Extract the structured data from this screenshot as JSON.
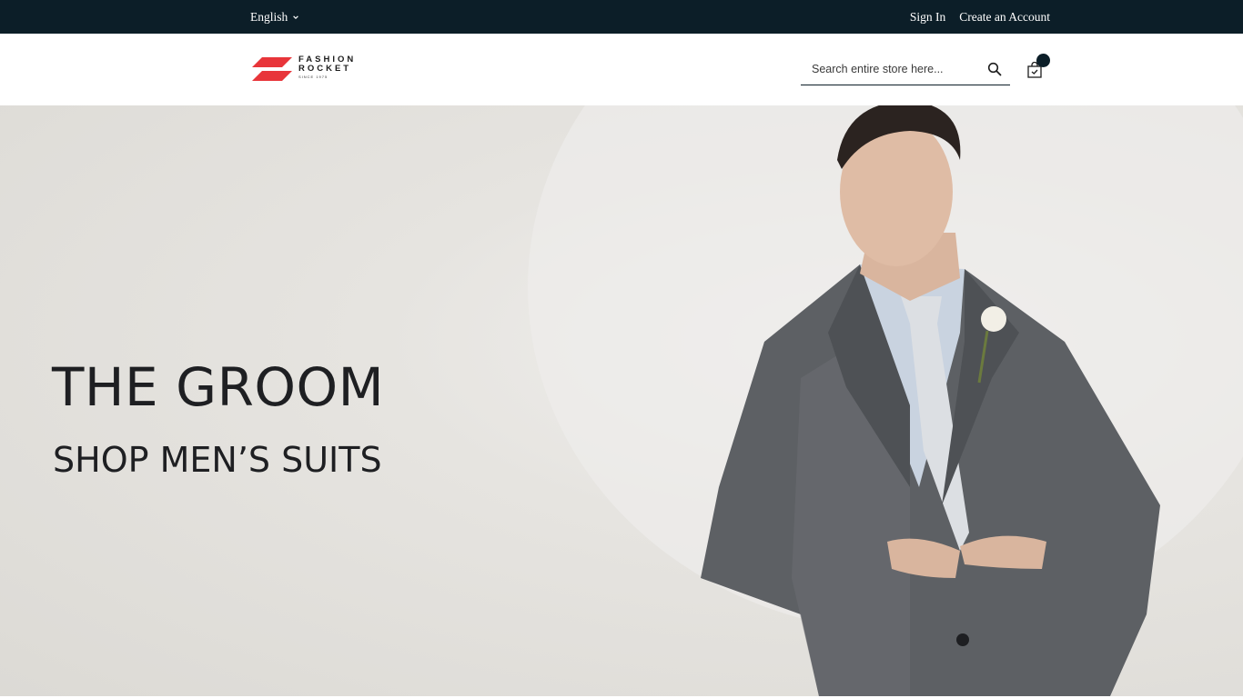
{
  "topbar": {
    "language": "English",
    "sign_in": "Sign In",
    "create_account": "Create an Account"
  },
  "header": {
    "logo": {
      "line1": "FASHION",
      "line2": "ROCKET",
      "since": "SINCE 1975"
    },
    "search": {
      "placeholder": "Search entire store here..."
    },
    "cart_icon": "shopping-bag-icon"
  },
  "hero": {
    "title": "THE GROOM",
    "subtitle": "SHOP MEN’S SUITS"
  },
  "colors": {
    "topbar_bg": "#0c1e28",
    "brand_red": "#e8353a",
    "hero_bg": "#e2e0dc"
  }
}
